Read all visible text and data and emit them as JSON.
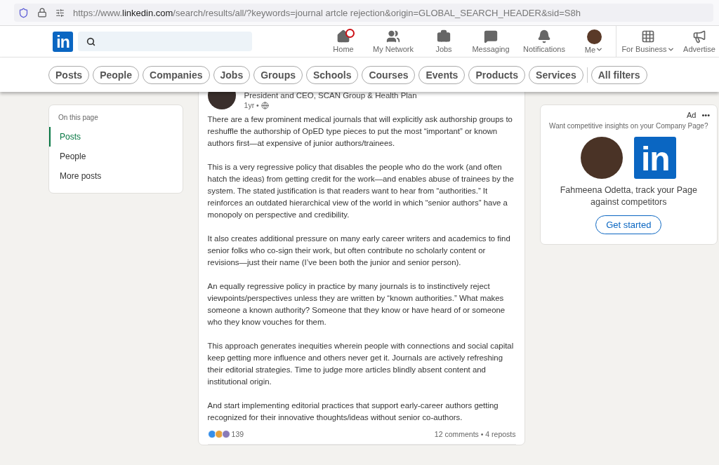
{
  "browser": {
    "url_host_prefix": "https://www.",
    "url_host": "linkedin.com",
    "url_path": "/search/results/all/?keywords=journal artcle rejection&origin=GLOBAL_SEARCH_HEADER&sid=S8h"
  },
  "nav": {
    "logo": "in",
    "items": [
      {
        "label": "Home",
        "badge": true,
        "caret": false
      },
      {
        "label": "My Network",
        "badge": false,
        "caret": false
      },
      {
        "label": "Jobs",
        "badge": false,
        "caret": false
      },
      {
        "label": "Messaging",
        "badge": false,
        "caret": false
      },
      {
        "label": "Notifications",
        "badge": false,
        "caret": false
      },
      {
        "label": "Me",
        "badge": false,
        "caret": true
      },
      {
        "label": "For Business",
        "badge": false,
        "caret": true
      },
      {
        "label": "Advertise",
        "badge": false,
        "caret": false
      }
    ]
  },
  "filters": [
    "Posts",
    "People",
    "Companies",
    "Jobs",
    "Groups",
    "Schools",
    "Courses",
    "Events",
    "Products",
    "Services"
  ],
  "all_filters": "All filters",
  "sidebar": {
    "title": "On this page",
    "items": [
      {
        "label": "Posts",
        "selected": true
      },
      {
        "label": "People",
        "selected": false
      },
      {
        "label": "More posts",
        "selected": false
      }
    ]
  },
  "post": {
    "author_subtitle": "President and CEO, SCAN Group & Health Plan",
    "age": "1yr •",
    "paragraphs": [
      "There are a few prominent medical journals that will explicitly ask authorship groups to reshuffle the authorship of OpED type pieces to put the most “important” or known authors first—at expensive of junior authors/trainees.",
      "This is a very regressive policy that disables the people who do the work (and often hatch the ideas) from getting credit for the work—and enables abuse of trainees by the system. The stated justification is that readers want to hear from “authorities.” It reinforces an outdated hierarchical view of the world in which “senior authors” have a monopoly on perspective and credibility.",
      "It also creates additional pressure on many early career writers and academics to find senior folks who co-sign their work, but often contribute no scholarly content or revisions—just their name (I’ve been both the junior and senior person).",
      "An equally regressive policy in practice by many journals is to instinctively reject viewpoints/perspectives unless they are written by “known authorities.” What makes someone a known authority? Someone that they know or have heard of or someone who they know vouches for them.",
      "This approach generates inequities wherein people with connections and social capital keep getting more influence and others never get it. Journals are actively refreshing their editorial strategies. Time to judge more articles blindly absent content and institutional origin.",
      "And start implementing editorial practices that support early-career authors getting recognized for their innovative thoughts/ideas without senior co-authors."
    ],
    "reactions_count": "139",
    "comments_reposts": "12 comments • 4 reposts"
  },
  "ad": {
    "label": "Ad",
    "menu": "•••",
    "headline": "Want competitive insights on your Company Page?",
    "logo": "in",
    "message": "Fahmeena Odetta, track your Page against competitors",
    "button": "Get started"
  }
}
